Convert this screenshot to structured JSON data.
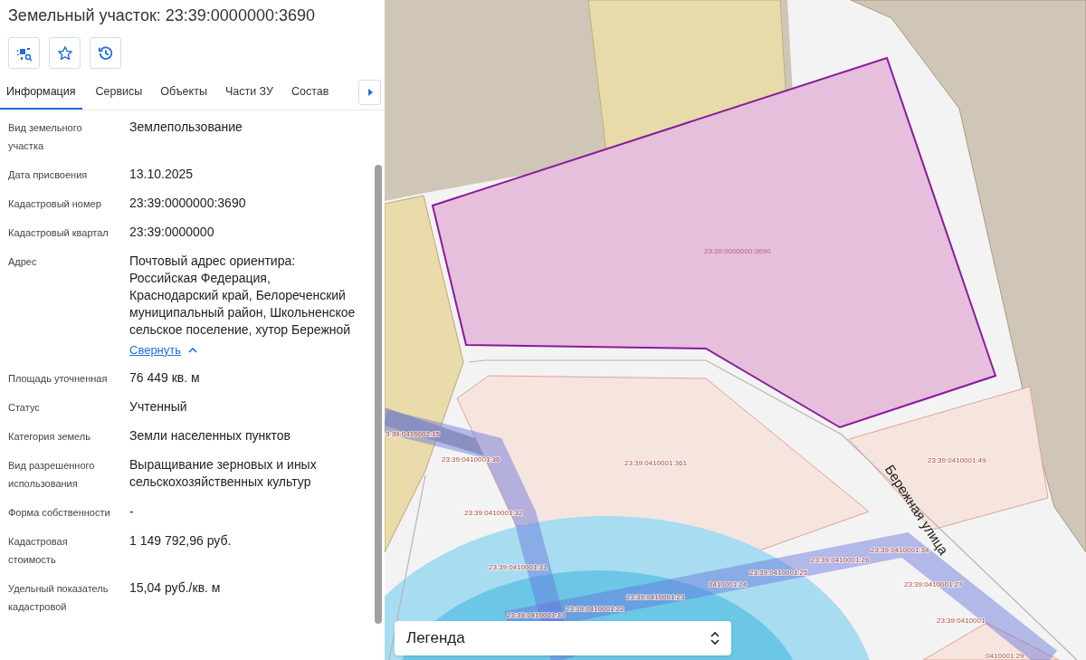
{
  "title": "Земельный участок: 23:39:0000000:3690",
  "tabs": [
    {
      "label": "Информация",
      "selected": true
    },
    {
      "label": "Сервисы",
      "selected": false
    },
    {
      "label": "Объекты",
      "selected": false
    },
    {
      "label": "Части ЗУ",
      "selected": false
    },
    {
      "label": "Состав",
      "selected": false
    }
  ],
  "fields": [
    {
      "label": "Вид земельного участка",
      "value": "Землепользование"
    },
    {
      "label": "Дата присвоения",
      "value": "13.10.2025"
    },
    {
      "label": "Кадастровый номер",
      "value": "23:39:0000000:3690"
    },
    {
      "label": "Кадастровый квартал",
      "value": "23:39:0000000"
    },
    {
      "label": "Адрес",
      "value": "Почтовый адрес ориентира: Российская Федерация, Краснодарский край, Белореченский муниципальный район, Школьненское сельское поселение, хутор Бережной",
      "toggle": {
        "text": "Свернуть",
        "expanded": true
      }
    },
    {
      "label": "Площадь уточненная",
      "value": "76 449 кв. м"
    },
    {
      "label": "Статус",
      "value": "Учтенный"
    },
    {
      "label": "Категория земель",
      "value": "Земли населенных пунктов"
    },
    {
      "label": "Вид разрешенного использования",
      "value": "Выращивание зерновых и иных сельскохозяйственных культур"
    },
    {
      "label": "Форма собственности",
      "value": "-"
    },
    {
      "label": "Кадастровая стоимость",
      "value": "1 149 792,96 руб."
    },
    {
      "label": "Удельный показатель кадастровой",
      "value": "15,04 руб./кв. м"
    }
  ],
  "map": {
    "street": "Бережная улица",
    "parcel_labels": [
      "23:39:0000000:3690",
      "3:39:0410002:15",
      "23:39:0410001:36",
      "23:39:0410001:361",
      "23:39:0410001:49",
      "23:39:0410001:32",
      "23:39:0410001:31",
      "23:39:0410001:34",
      "23:39:0410001:26",
      "23:39:0410001:25",
      "0410001:24",
      "23:39:0410001:23",
      "23:39:0410001:27",
      "23:39:0410001:22",
      "23:39:0410001",
      "23:39:0410001:33",
      ":0410001:29"
    ],
    "legend": "Легенда"
  }
}
